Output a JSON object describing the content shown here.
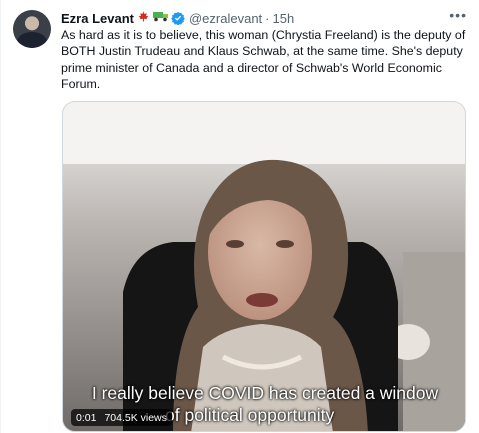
{
  "tweet": {
    "author_name": "Ezra Levant",
    "handle": "@ezralevant",
    "separator": "·",
    "time": "15h",
    "more_label": "•••",
    "icons": [
      "canada-flag-icon",
      "truck-icon",
      "verified-badge-icon"
    ],
    "text": "As hard as it is to believe, this woman (Chrystia Freeland) is the deputy of BOTH Justin Trudeau and Klaus Schwab, at the same time. She's deputy prime minister of Canada and a director of Schwab's World Economic Forum.",
    "video": {
      "caption_line1": "I really believe COVID has created a window",
      "caption_line2": "of political opportunity",
      "elapsed": "0:01",
      "views": "704.5K views"
    }
  },
  "colors": {
    "verified": "#1d9bf0",
    "secondary_text": "#536471",
    "flag_red": "#d52b1e",
    "truck_green": "#4caf50"
  }
}
